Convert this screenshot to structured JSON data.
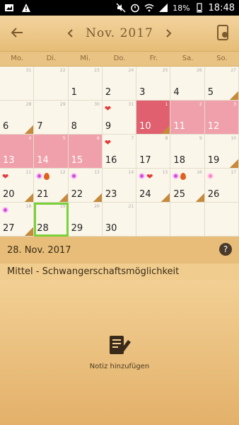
{
  "statusbar": {
    "battery": "18%",
    "time": "18:48"
  },
  "header": {
    "month": "Nov. 2017"
  },
  "weekdays": [
    "Mo.",
    "Di.",
    "Mi.",
    "Do.",
    "Fr.",
    "Sa.",
    "So."
  ],
  "calendar": {
    "rows": [
      [
        {
          "day": "",
          "small": "31"
        },
        {
          "day": "",
          "small": "22"
        },
        {
          "day": "1",
          "small": "23"
        },
        {
          "day": "2",
          "small": "24"
        },
        {
          "day": "3",
          "small": "25"
        },
        {
          "day": "4",
          "small": "26"
        },
        {
          "day": "5",
          "small": "27"
        }
      ],
      [
        {
          "day": "6",
          "small": "28"
        },
        {
          "day": "7",
          "small": "29"
        },
        {
          "day": "8",
          "small": "30"
        },
        {
          "day": "9",
          "small": "31"
        },
        {
          "day": "10",
          "small": "1"
        },
        {
          "day": "11",
          "small": "2"
        },
        {
          "day": "12",
          "small": "3"
        }
      ],
      [
        {
          "day": "13",
          "small": "4"
        },
        {
          "day": "14",
          "small": "5"
        },
        {
          "day": "15",
          "small": "6"
        },
        {
          "day": "16",
          "small": "7"
        },
        {
          "day": "17",
          "small": "8"
        },
        {
          "day": "18",
          "small": "9"
        },
        {
          "day": "19",
          "small": "10"
        }
      ],
      [
        {
          "day": "20",
          "small": "11"
        },
        {
          "day": "21",
          "small": "12"
        },
        {
          "day": "22",
          "small": "13"
        },
        {
          "day": "23",
          "small": "14"
        },
        {
          "day": "24",
          "small": "15"
        },
        {
          "day": "25",
          "small": "16"
        },
        {
          "day": "26",
          "small": "17"
        }
      ],
      [
        {
          "day": "27",
          "small": "18"
        },
        {
          "day": "28",
          "small": "19"
        },
        {
          "day": "29",
          "small": "20"
        },
        {
          "day": "30",
          "small": "21"
        },
        {
          "day": "",
          "small": ""
        },
        {
          "day": "",
          "small": ""
        },
        {
          "day": "",
          "small": ""
        }
      ]
    ]
  },
  "info": {
    "date": "28. Nov. 2017",
    "status": "Mittel - Schwangerschaftsmöglichkeit",
    "note_label": "Notiz hinzufügen"
  },
  "colors": {
    "period_strong": "#e0606f",
    "period": "#f0a0aa",
    "selected_outline": "#7ad13a"
  }
}
